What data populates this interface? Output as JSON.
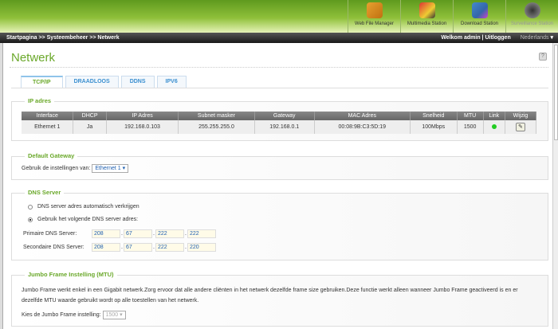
{
  "apps": [
    {
      "label": "Web File Manager"
    },
    {
      "label": "Multimedia Station"
    },
    {
      "label": "Download Station"
    },
    {
      "label": "Surveillance Station"
    }
  ],
  "breadcrumb": "Startpagina >> Systeembeheer >> Netwerk",
  "welcome": "Welkom admin | Uitloggen",
  "language": "Nederlands",
  "page_title": "Netwerk",
  "help": "?",
  "tabs": [
    "TCP/IP",
    "DRAADLOOS",
    "DDNS",
    "IPV6"
  ],
  "ip": {
    "legend": "IP adres",
    "headers": [
      "Interface",
      "DHCP",
      "IP Adres",
      "Subnet masker",
      "Gateway",
      "MAC Adres",
      "Snelheid",
      "MTU",
      "Link",
      "Wijzig"
    ],
    "rows": [
      [
        "Ethernet 1",
        "Ja",
        "192.168.0.103",
        "255.255.255.0",
        "192.168.0.1",
        "00:08:9B:C3:5D:19",
        "100Mbps",
        "1500"
      ]
    ],
    "link_color": "#22cc22"
  },
  "gateway": {
    "legend": "Default Gateway",
    "label": "Gebruik de instellingen van:",
    "value": "Ethernet 1"
  },
  "dns": {
    "legend": "DNS Server",
    "auto": "DNS server adres automatisch verkrijgen",
    "manual": "Gebruik het volgende DNS server adres:",
    "primary_label": "Primaire DNS Server:",
    "secondary_label": "Secondaire DNS Server:",
    "primary": [
      "208",
      "67",
      "222",
      "222"
    ],
    "secondary": [
      "208",
      "67",
      "222",
      "220"
    ],
    "sep": "."
  },
  "jumbo": {
    "legend": "Jumbo Frame Instelling (MTU)",
    "text": "Jumbo Frame werkt enkel in een Gigabit netwerk.Zorg ervoor dat alle andere cliënten in het netwerk dezelfde frame size gebruiken.Deze functie werkt alleen wanneer Jumbo Frame geactiveerd is en er dezelfde MTU waarde gebruikt wordt op alle toestellen van het netwerk.",
    "label": "Kies de Jumbo Frame instelling:",
    "value": "1500"
  }
}
